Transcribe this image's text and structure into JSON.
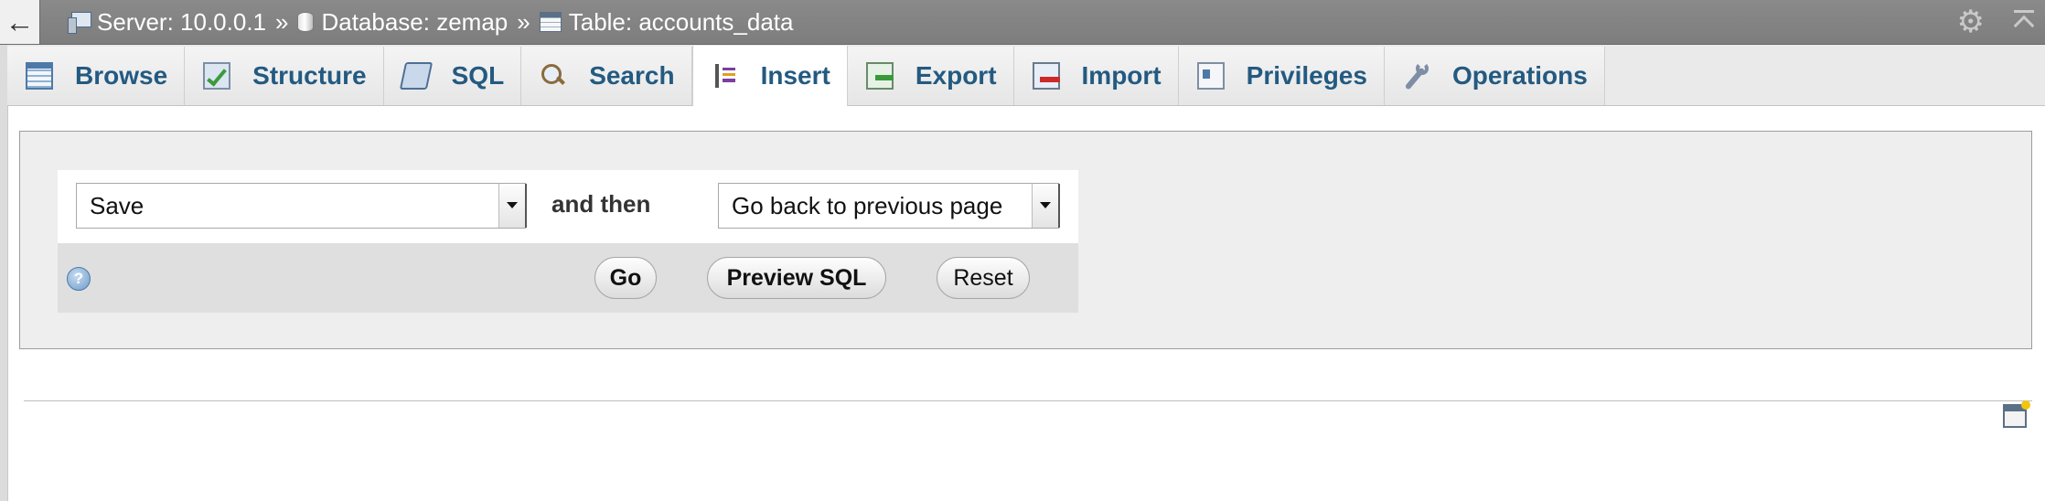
{
  "breadcrumb": {
    "back_arrow": "←",
    "server": "Server: 10.0.0.1",
    "sep1": "»",
    "database": "Database: zemap",
    "sep2": "»",
    "table": "Table: accounts_data"
  },
  "tabs": [
    {
      "label": "Browse",
      "icon": "browse-icon",
      "active": false
    },
    {
      "label": "Structure",
      "icon": "structure-icon",
      "active": false
    },
    {
      "label": "SQL",
      "icon": "sql-icon",
      "active": false
    },
    {
      "label": "Search",
      "icon": "search-icon",
      "active": false
    },
    {
      "label": "Insert",
      "icon": "insert-icon",
      "active": true
    },
    {
      "label": "Export",
      "icon": "export-icon",
      "active": false
    },
    {
      "label": "Import",
      "icon": "import-icon",
      "active": false
    },
    {
      "label": "Privileges",
      "icon": "privileges-icon",
      "active": false
    },
    {
      "label": "Operations",
      "icon": "operations-icon",
      "active": false
    }
  ],
  "form": {
    "action_select": "Save",
    "and_then": "and then",
    "after_select": "Go back to previous page",
    "help_glyph": "?",
    "go_button": "Go",
    "preview_button": "Preview SQL",
    "reset_button": "Reset"
  },
  "top_icons": {
    "settings": "⚙"
  },
  "colors": {
    "tab_text": "#235a81",
    "topbar": "#858585"
  }
}
